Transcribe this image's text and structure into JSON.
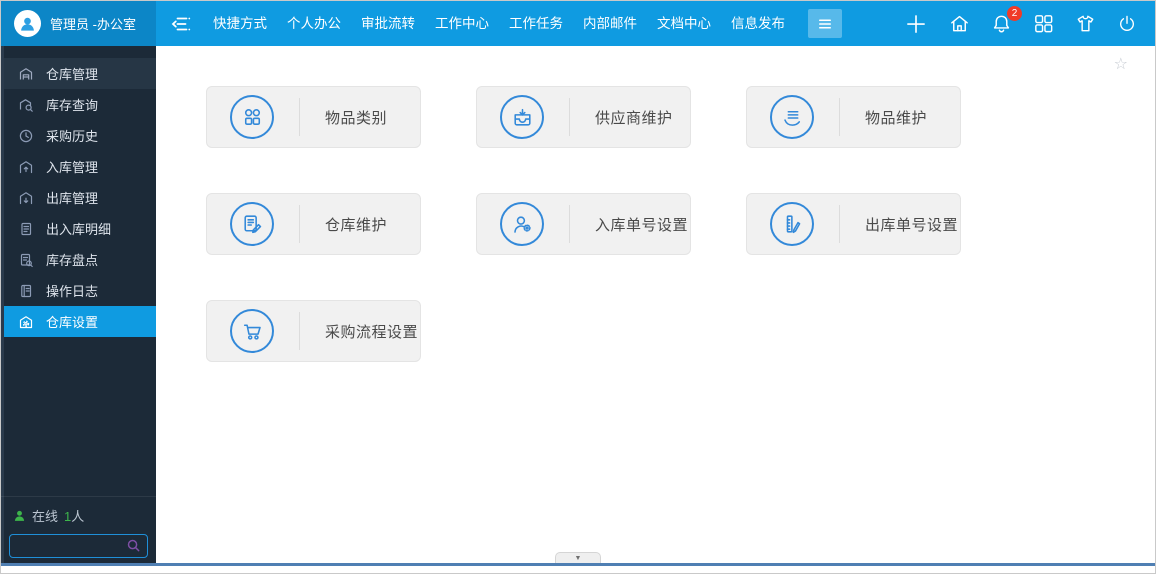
{
  "colors": {
    "navbar_blue": "#0F9BE1",
    "navbar_user_blue": "#0C86C7",
    "sidebar_dark": "#1C2A38",
    "selected_blue": "#0F9BE1",
    "tile_icon_blue": "#3389D9",
    "online_green": "#3DB54B",
    "badge_red": "#F03B28",
    "bottom_line_blue": "#4F7FB3"
  },
  "navbar": {
    "user_name": "管理员 -办公室",
    "user_avatar_icon": "user-avatar-icon",
    "collapse_menu_icon": "collapse-menu-icon",
    "menu_items": [
      "快捷方式",
      "个人办公",
      "审批流转",
      "工作中心",
      "工作任务",
      "内部邮件",
      "文档中心",
      "信息发布"
    ],
    "more_menu_icon": "hamburger-menu-icon",
    "notification_count": "2",
    "right_icons": [
      "add-icon",
      "home-icon",
      "notification-bell-icon",
      "apps-grid-icon",
      "theme-shirt-icon",
      "power-icon"
    ]
  },
  "sidebar": {
    "items": [
      {
        "label": "仓库管理",
        "icon": "warehouse-icon",
        "state": "open"
      },
      {
        "label": "库存查询",
        "icon": "inventory-search-icon",
        "state": "normal"
      },
      {
        "label": "采购历史",
        "icon": "purchase-history-clock-icon",
        "state": "normal"
      },
      {
        "label": "入库管理",
        "icon": "inbound-warehouse-icon",
        "state": "normal"
      },
      {
        "label": "出库管理",
        "icon": "outbound-warehouse-icon",
        "state": "normal"
      },
      {
        "label": "出入库明细",
        "icon": "inout-detail-doc-icon",
        "state": "normal"
      },
      {
        "label": "库存盘点",
        "icon": "stocktake-doc-search-icon",
        "state": "normal"
      },
      {
        "label": "操作日志",
        "icon": "operation-log-icon",
        "state": "normal"
      },
      {
        "label": "仓库设置",
        "icon": "warehouse-settings-icon",
        "state": "selected"
      }
    ],
    "online": {
      "prefix": "在线",
      "count": "1",
      "suffix": "人"
    },
    "search_placeholder": ""
  },
  "main": {
    "favorite_star": "☆",
    "tiles": [
      {
        "label": "物品类别",
        "icon": "item-category-icon"
      },
      {
        "label": "供应商维护",
        "icon": "supplier-maintenance-icon"
      },
      {
        "label": "物品维护",
        "icon": "item-maintenance-icon"
      },
      {
        "label": "仓库维护",
        "icon": "warehouse-maintenance-icon"
      },
      {
        "label": "入库单号设置",
        "icon": "inbound-number-setting-icon"
      },
      {
        "label": "出库单号设置",
        "icon": "outbound-number-setting-icon"
      },
      {
        "label": "采购流程设置",
        "icon": "purchase-flow-setting-icon"
      }
    ]
  },
  "footer": {
    "collapse_arrow": "▼"
  }
}
